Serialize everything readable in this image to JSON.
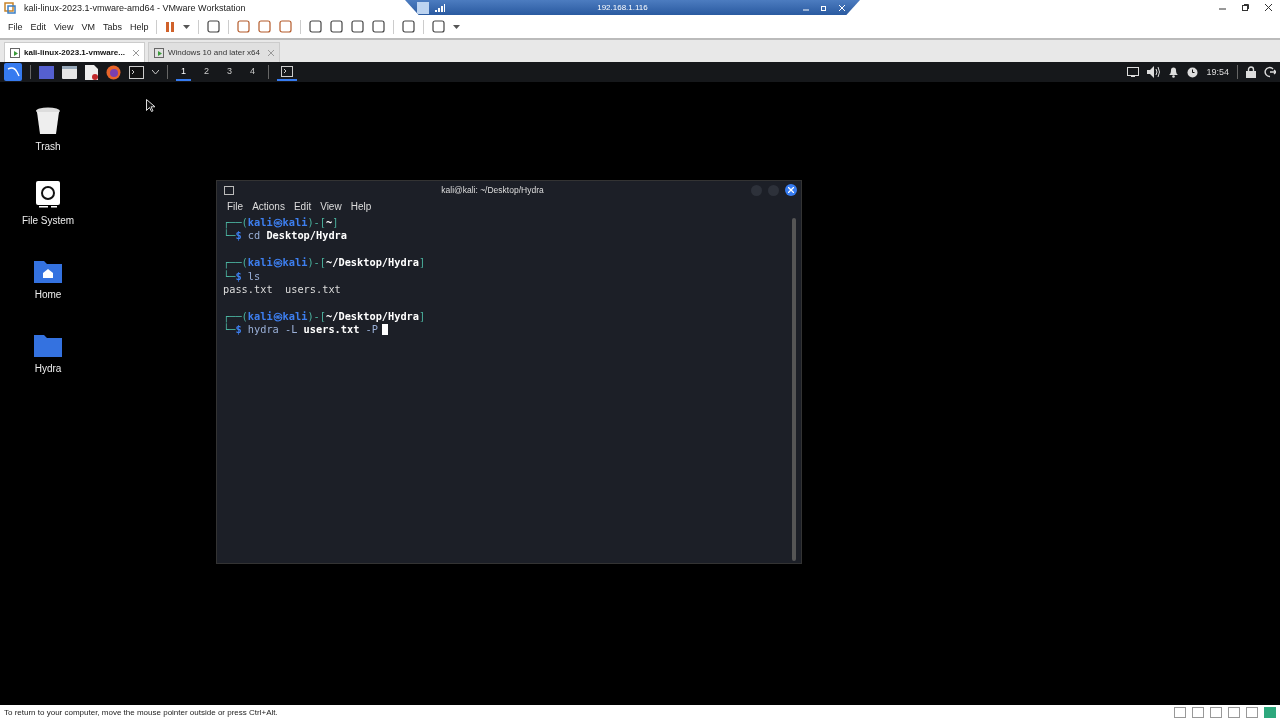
{
  "window": {
    "title": "kali-linux-2023.1-vmware-amd64 - VMware Workstation"
  },
  "remote_bar": {
    "address": "192.168.1.116"
  },
  "menu": [
    "File",
    "Edit",
    "View",
    "VM",
    "Tabs",
    "Help"
  ],
  "tabs": [
    {
      "label": "kali-linux-2023.1-vmware...",
      "selected": true
    },
    {
      "label": "Windows 10 and later x64",
      "selected": false
    }
  ],
  "panel": {
    "workspaces": [
      {
        "label": "1",
        "selected": true
      },
      {
        "label": "2",
        "selected": false
      },
      {
        "label": "3",
        "selected": false
      },
      {
        "label": "4",
        "selected": false
      }
    ],
    "clock": "19:54"
  },
  "desktop_icons": [
    {
      "label": "Trash",
      "kind": "trash"
    },
    {
      "label": "File System",
      "kind": "drive"
    },
    {
      "label": "Home",
      "kind": "home"
    },
    {
      "label": "Hydra",
      "kind": "folder"
    }
  ],
  "terminal": {
    "title": "kali@kali: ~/Desktop/Hydra",
    "menu": [
      "File",
      "Actions",
      "Edit",
      "View",
      "Help"
    ],
    "lines": [
      {
        "kind": "prompt",
        "parts": [
          {
            "kind": "frame",
            "text": "┌──("
          },
          {
            "kind": "user",
            "text": "kali㉿kali"
          },
          {
            "kind": "frame",
            "text": ")-["
          },
          {
            "kind": "path",
            "text": "~"
          },
          {
            "kind": "frame",
            "text": "]"
          }
        ]
      },
      {
        "kind": "command",
        "parts": [
          {
            "kind": "frame",
            "text": "└─"
          },
          {
            "kind": "user",
            "text": "$"
          }
        ],
        "command": "cd **Desktop/Hydra**"
      },
      {
        "kind": "blank"
      },
      {
        "kind": "prompt",
        "parts": [
          {
            "kind": "frame",
            "text": "┌──("
          },
          {
            "kind": "user",
            "text": "kali㉿kali"
          },
          {
            "kind": "frame",
            "text": ")-["
          },
          {
            "kind": "path",
            "text": "~/Desktop/Hydra"
          },
          {
            "kind": "frame",
            "text": "]"
          }
        ]
      },
      {
        "kind": "command",
        "parts": [
          {
            "kind": "frame",
            "text": "└─"
          },
          {
            "kind": "user",
            "text": "$"
          }
        ],
        "command": "ls"
      },
      {
        "kind": "output",
        "text": "pass.txt  users.txt"
      },
      {
        "kind": "blank"
      },
      {
        "kind": "prompt",
        "parts": [
          {
            "kind": "frame",
            "text": "┌──("
          },
          {
            "kind": "user",
            "text": "kali㉿kali"
          },
          {
            "kind": "frame",
            "text": ")-["
          },
          {
            "kind": "path",
            "text": "~/Desktop/Hydra"
          },
          {
            "kind": "frame",
            "text": "]"
          }
        ]
      },
      {
        "kind": "command",
        "parts": [
          {
            "kind": "frame",
            "text": "└─"
          },
          {
            "kind": "user",
            "text": "$"
          }
        ],
        "command": "hydra -L **users.txt** -P",
        "cursor": true
      }
    ]
  },
  "status_bar": {
    "text": "To return to your computer, move the mouse pointer outside or press Ctrl+Alt."
  }
}
